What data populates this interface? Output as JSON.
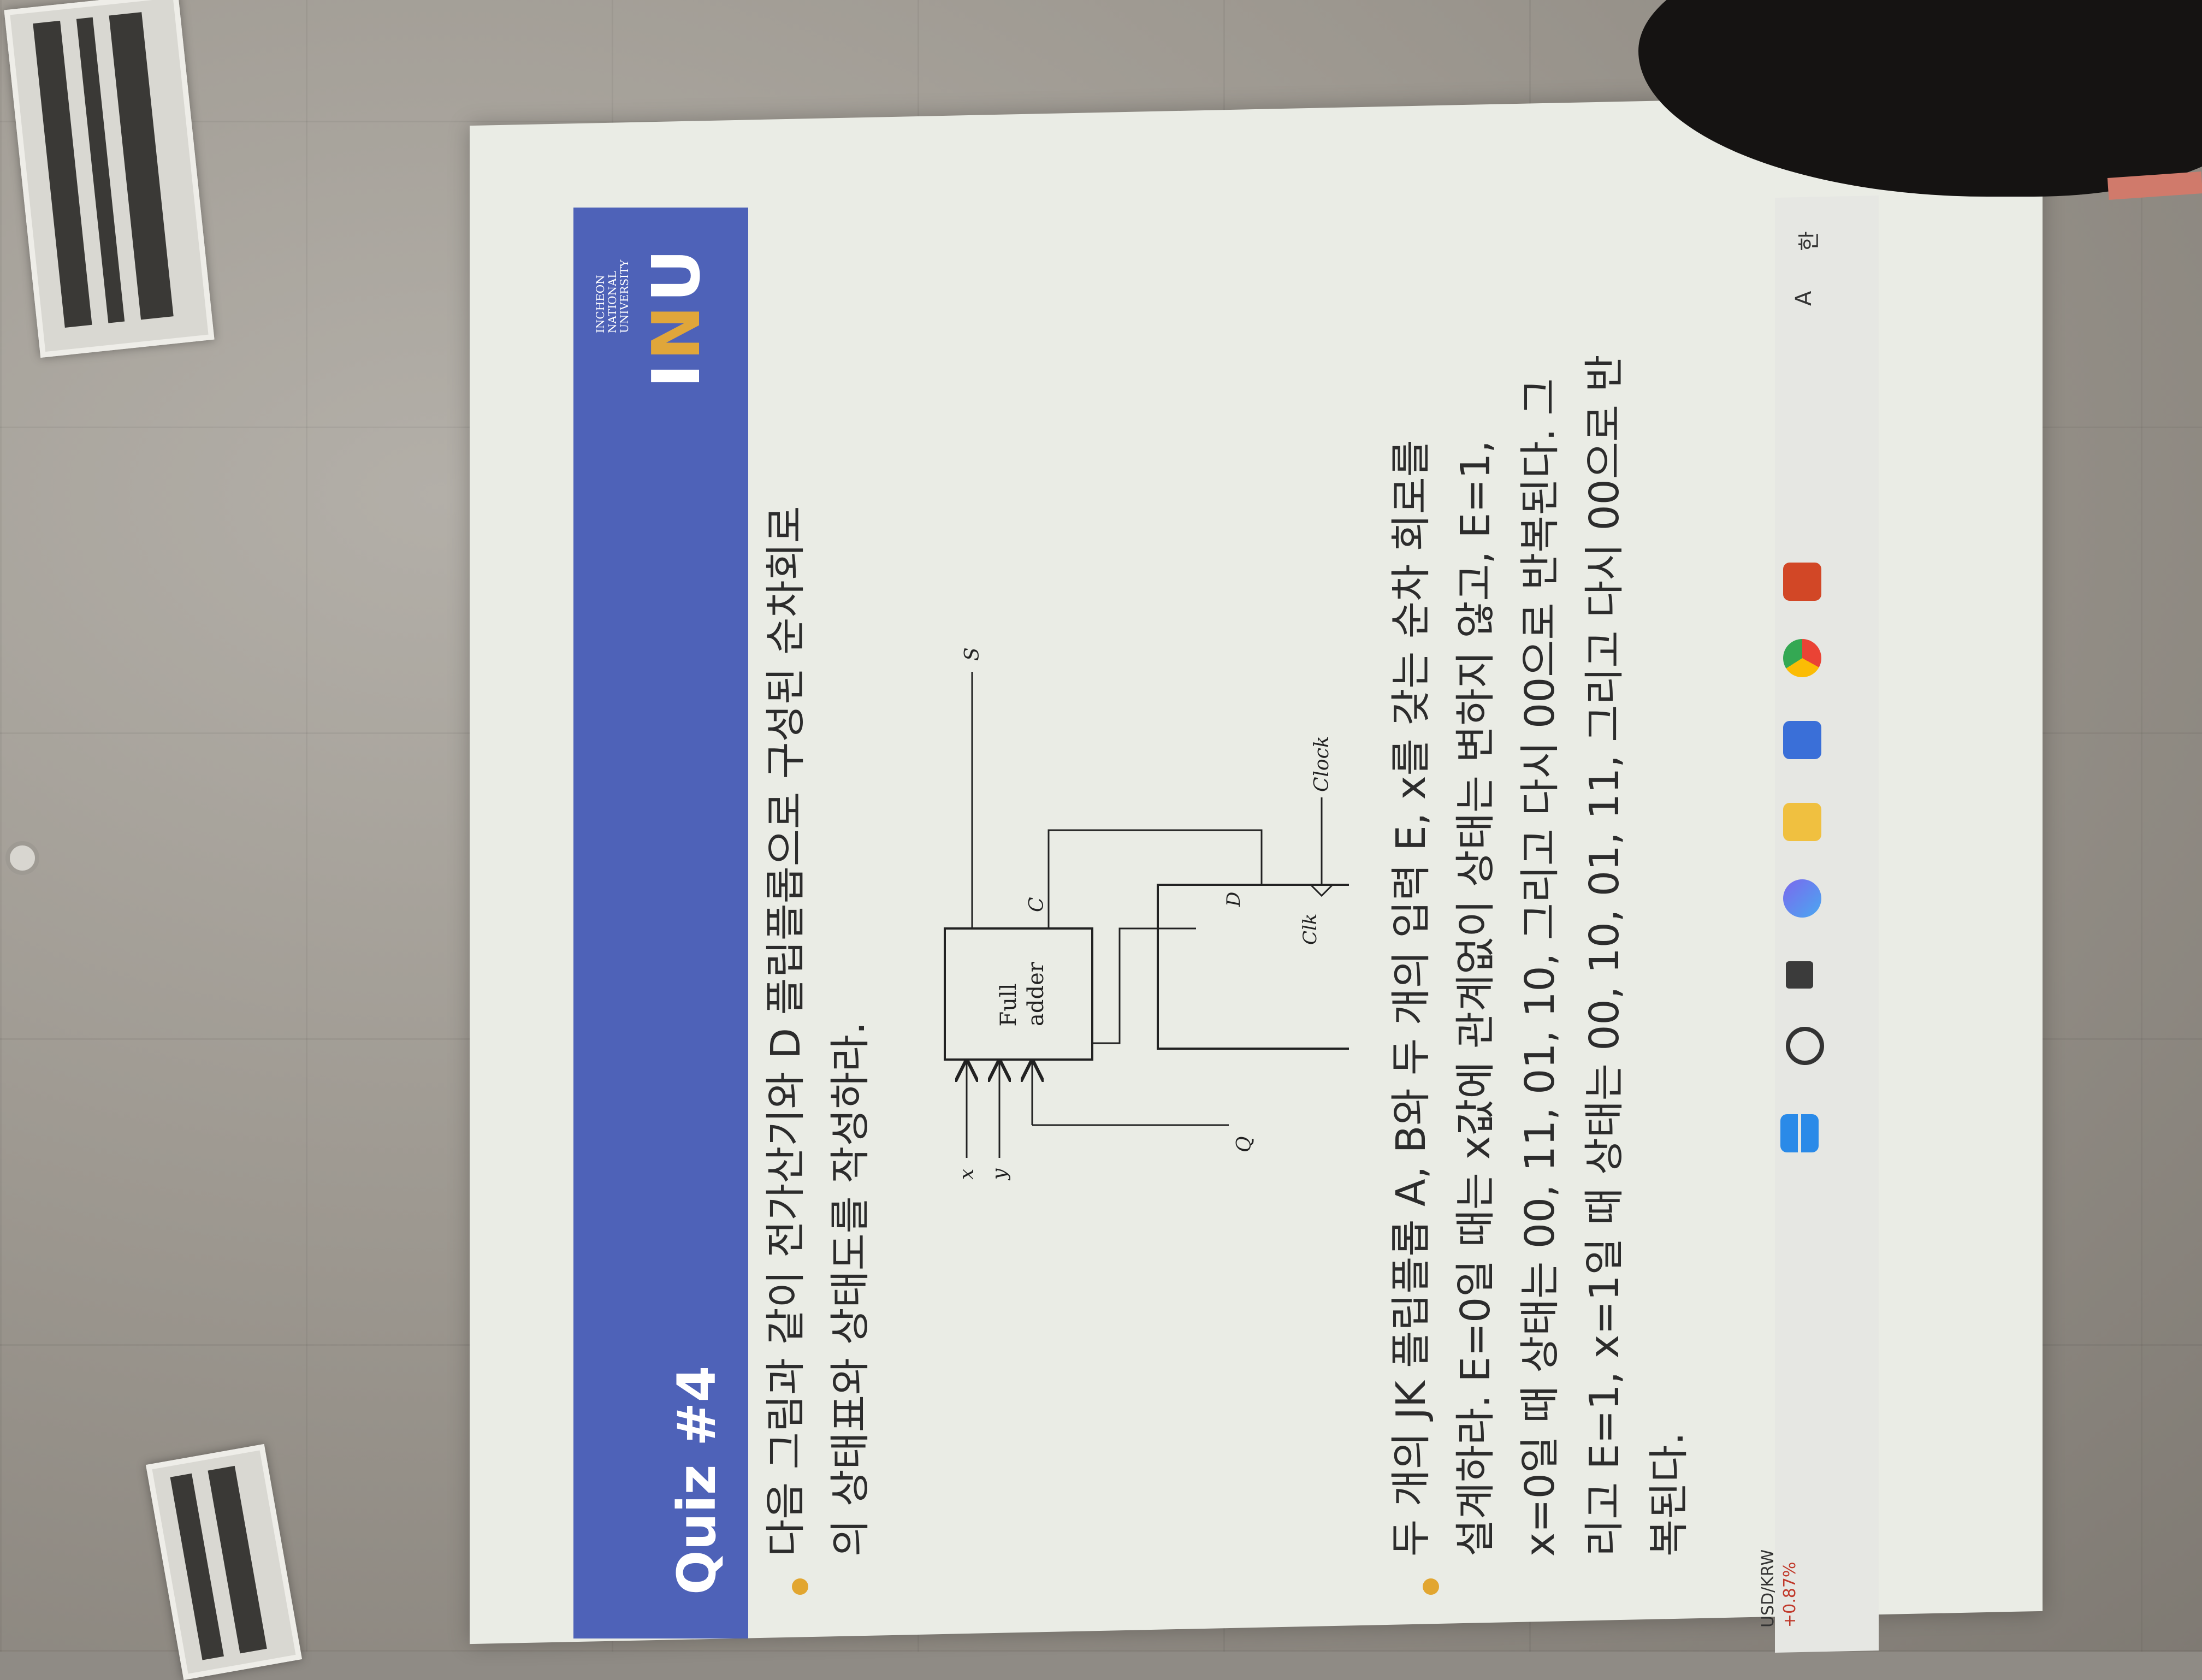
{
  "slide": {
    "title": "Quiz #4",
    "logo": {
      "university_lines": [
        "INCHEON",
        "NATIONAL",
        "UNIVERSITY"
      ],
      "mark_left": "I",
      "mark_accent": "N",
      "mark_right": "U"
    },
    "bullet1_lines": [
      "다음 그림과 같이 전가산기와 D 플립플롭으로 구성된 순차회로",
      "의 상태표와 상태도를 작성하라."
    ],
    "bullet2_lines": [
      "두 개의 JK 플립플롭 A, B와 두 개의 입력 E, x를 갖는 순차 회로를",
      "설계하라. E=0일 때는 x값에 관계없이 상태는 변하지 않고, E=1,",
      "x=0일 때 상태는 00, 11, 01, 10, 그리고 다시 00으로 반복된다. 그",
      "리고 E=1, x=1일 때 상태는 00, 10, 01, 11, 그리고 다시 00으로 반",
      "복된다."
    ],
    "diagram": {
      "full_adder_line1": "Full",
      "full_adder_line2": "adder",
      "label_x": "x",
      "label_y": "y",
      "label_Q": "Q",
      "label_S": "S",
      "label_C": "C",
      "label_D": "D",
      "label_Clk": "Clk",
      "label_Clock": "Clock"
    }
  },
  "taskbar": {
    "ticker_name": "USD/KRW",
    "ticker_change": "+0.87%",
    "tray_A": "A",
    "tray_han": "한",
    "icons": [
      "windows-start-icon",
      "search-icon",
      "task-view-icon",
      "copilot-icon",
      "file-explorer-icon",
      "microsoft-store-icon",
      "chrome-icon",
      "powerpoint-icon"
    ]
  },
  "colors": {
    "header_blue": "#4e62b8",
    "bullet_orange": "#e2a630",
    "slide_background": "#eaece5"
  }
}
